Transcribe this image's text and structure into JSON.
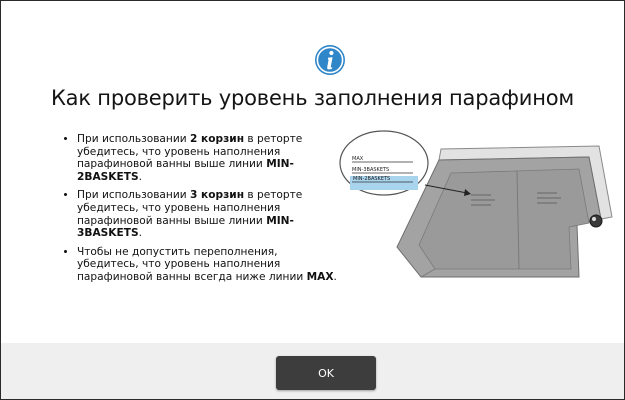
{
  "dialog": {
    "icon": "info-icon",
    "title": "Как проверить уровень заполнения парафином",
    "bullets": [
      {
        "pre": "При использовании ",
        "strong": "2 корзин",
        "mid": " в реторте убедитесь, что уровень наполнения парафиновой ванны выше линии ",
        "strong2": "MIN-2BASKETS",
        "post": "."
      },
      {
        "pre": "При использовании ",
        "strong": "3 корзин",
        "mid": " в реторте убедитесь, что уровень наполнения парафиновой ванны выше линии ",
        "strong2": "MIN-3BASKETS",
        "post": "."
      },
      {
        "pre": "Чтобы не допустить переполнения, убедитесь, что уровень наполнения парафиновой ванны всегда ниже линии ",
        "strong": "MAX",
        "mid": "",
        "strong2": "",
        "post": "."
      }
    ],
    "ok_label": "OK"
  },
  "illustration": {
    "label_max": "MAX",
    "label_min3": "MIN-3BASKETS",
    "label_min2": "MIN-2BASKETS"
  },
  "colors": {
    "accent": "#2f86c8",
    "button": "#3d3d3d",
    "footer": "#efefef",
    "bath": "#a3a3a3",
    "wax": "#a8d4ee"
  }
}
